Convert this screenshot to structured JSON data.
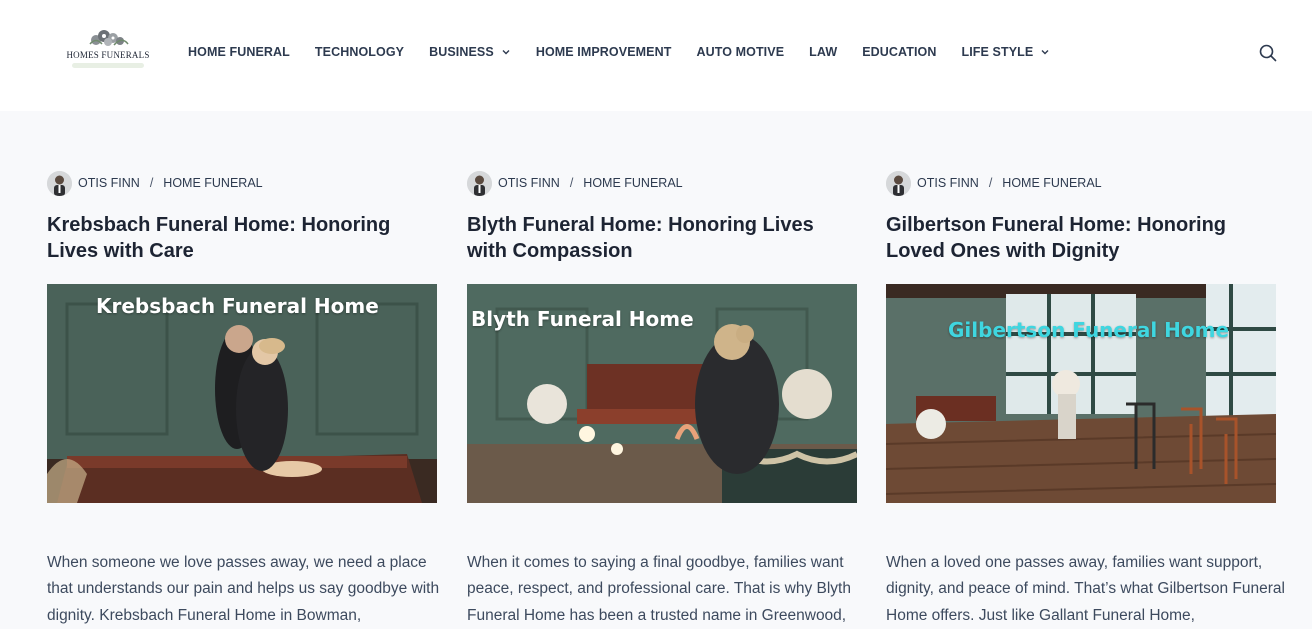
{
  "brand": {
    "logo_text": "HOMES FUNERALS"
  },
  "nav": {
    "items": [
      {
        "label": "HOME FUNERAL",
        "has_dropdown": false
      },
      {
        "label": "TECHNOLOGY",
        "has_dropdown": false
      },
      {
        "label": "BUSINESS",
        "has_dropdown": true
      },
      {
        "label": "HOME IMPROVEMENT",
        "has_dropdown": false
      },
      {
        "label": "AUTO MOTIVE",
        "has_dropdown": false
      },
      {
        "label": "LAW",
        "has_dropdown": false
      },
      {
        "label": "EDUCATION",
        "has_dropdown": false
      },
      {
        "label": "LIFE STYLE",
        "has_dropdown": true
      }
    ],
    "search_icon": "search-icon"
  },
  "posts": [
    {
      "author": "OTIS FINN",
      "category": "HOME FUNERAL",
      "title": "Krebsbach Funeral Home: Honoring Lives with Care",
      "image_label": "Krebsbach Funeral Home",
      "image_label_color": "#ffffff",
      "excerpt": "When someone we love passes away, we need a place that understands our pain and helps us say goodbye with dignity. Krebsbach Funeral Home in Bowman,"
    },
    {
      "author": "OTIS FINN",
      "category": "HOME FUNERAL",
      "title": "Blyth Funeral Home: Honoring Lives with Compassion",
      "image_label": "Blyth Funeral Home",
      "image_label_color": "#ffffff",
      "excerpt": "When it comes to saying a final goodbye, families want peace, respect, and professional care. That is why Blyth Funeral Home has been a trusted name in Greenwood,"
    },
    {
      "author": "OTIS FINN",
      "category": "HOME FUNERAL",
      "title": "Gilbertson Funeral Home: Honoring Loved Ones with Dignity",
      "image_label": "Gilbertson Funeral Home",
      "image_label_color": "#3fd6e0",
      "excerpt": "When a loved one passes away, families want support, dignity, and peace of mind. That’s what Gilbertson Funeral Home offers. Just like Gallant Funeral Home,"
    }
  ],
  "colors": {
    "page_bg": "#f8f9fb",
    "header_bg": "#ffffff",
    "text": "#1d2433",
    "wall_green": "#4f6a60"
  }
}
